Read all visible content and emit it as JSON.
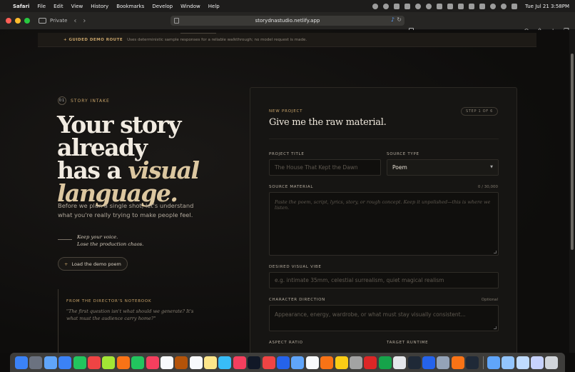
{
  "menubar": {
    "app": "Safari",
    "items": [
      "File",
      "Edit",
      "View",
      "History",
      "Bookmarks",
      "Develop",
      "Window",
      "Help"
    ],
    "clock": "Tue Jul 21  3:58PM"
  },
  "browser": {
    "private_label": "Private",
    "url": "storydnastudio.netlify.app"
  },
  "banner": {
    "tag": "+ GUIDED DEMO ROUTE",
    "message": "Uses deterministic sample responses for a reliable walkthrough; no model request is made."
  },
  "intake": {
    "number": "01",
    "label": "STORY INTAKE"
  },
  "hero": {
    "line1": "Your story already",
    "line2_plain": "has a ",
    "line2_italic": "visual",
    "line3_italic": "language."
  },
  "subtitle": "Before we plan a single shot, let's understand what you're really trying to make people feel.",
  "voice": {
    "line1": "Keep your voice.",
    "line2": "Lose the production chaos."
  },
  "demo_button": {
    "plus": "+",
    "label": "Load the demo poem"
  },
  "notebook": {
    "title": "FROM THE DIRECTOR'S NOTEBOOK",
    "quote": "\"The first question isn't what should we generate? It's what must the audience carry home?\""
  },
  "form": {
    "eyebrow": "NEW PROJECT",
    "title": "Give me the raw material.",
    "step": "STEP 1 OF 6",
    "project_title_label": "PROJECT TITLE",
    "project_title_placeholder": "The House That Kept the Dawn",
    "source_type_label": "SOURCE TYPE",
    "source_type_value": "Poem",
    "source_material_label": "SOURCE MATERIAL",
    "source_material_count": "0 / 30,000",
    "source_material_placeholder": "Paste the poem, script, lyrics, story, or rough concept. Keep it unpolished—this is where we listen.",
    "vibe_label": "DESIRED VISUAL VIBE",
    "vibe_placeholder": "e.g. intimate 35mm, celestial surrealism, quiet magical realism",
    "character_label": "CHARACTER DIRECTION",
    "character_optional": "Optional",
    "character_placeholder": "Appearance, energy, wardrobe, or what must stay visually consistent...",
    "aspect_label": "ASPECT RATIO",
    "runtime_label": "TARGET RUNTIME"
  },
  "dock": {
    "colors": [
      "#3b82f6",
      "#6b7280",
      "#60a5fa",
      "#3b82f6",
      "#22c55e",
      "#ef4444",
      "#a3e635",
      "#f97316",
      "#22c55e",
      "#f43f5e",
      "#f8fafc",
      "#b45309",
      "#f8fafc",
      "#fde68a",
      "#38bdf8",
      "#f43f5e",
      "#111827",
      "#ef4444",
      "#2563eb",
      "#60a5fa",
      "#f8fafc",
      "#f97316",
      "#facc15",
      "#a3a3a3",
      "#dc2626",
      "#16a34a",
      "#e5e7eb",
      "#1f2937",
      "#2563eb",
      "#94a3b8",
      "#f97316",
      "#1f2937"
    ],
    "right_colors": [
      "#60a5fa",
      "#93c5fd",
      "#bfdbfe",
      "#c7d2fe",
      "#d1d5db"
    ]
  }
}
